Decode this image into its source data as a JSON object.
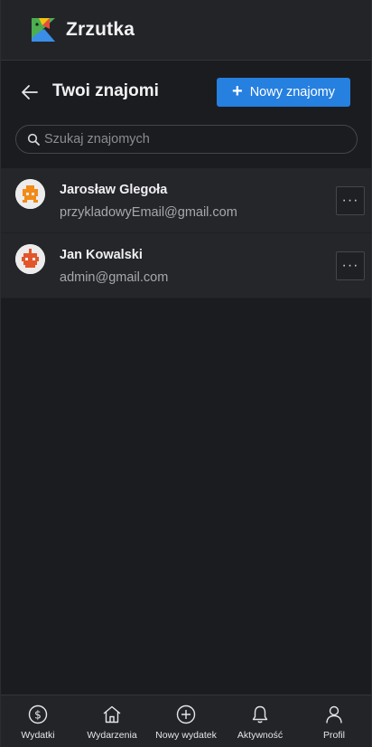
{
  "app": {
    "title": "Zrzutka"
  },
  "page": {
    "title": "Twoi znajomi",
    "add_button": "Nowy znajomy",
    "add_plus": "+"
  },
  "search": {
    "placeholder": "Szukaj znajomych",
    "value": ""
  },
  "friends": [
    {
      "name": "Jarosław Glegoła",
      "email": "przykladowyEmail@gmail.com",
      "more": "···",
      "avatar_color": "#f28a18"
    },
    {
      "name": "Jan Kowalski",
      "email": "admin@gmail.com",
      "more": "···",
      "avatar_color": "#e2572a"
    }
  ],
  "nav": [
    {
      "label": "Wydatki",
      "icon": "dollar-circle-icon"
    },
    {
      "label": "Wydarzenia",
      "icon": "home-icon"
    },
    {
      "label": "Nowy wydatek",
      "icon": "plus-circle-icon"
    },
    {
      "label": "Aktywność",
      "icon": "bell-icon"
    },
    {
      "label": "Profil",
      "icon": "user-icon"
    }
  ],
  "colors": {
    "accent": "#2680e0",
    "background": "#1b1c1f",
    "surface": "#25262a"
  }
}
